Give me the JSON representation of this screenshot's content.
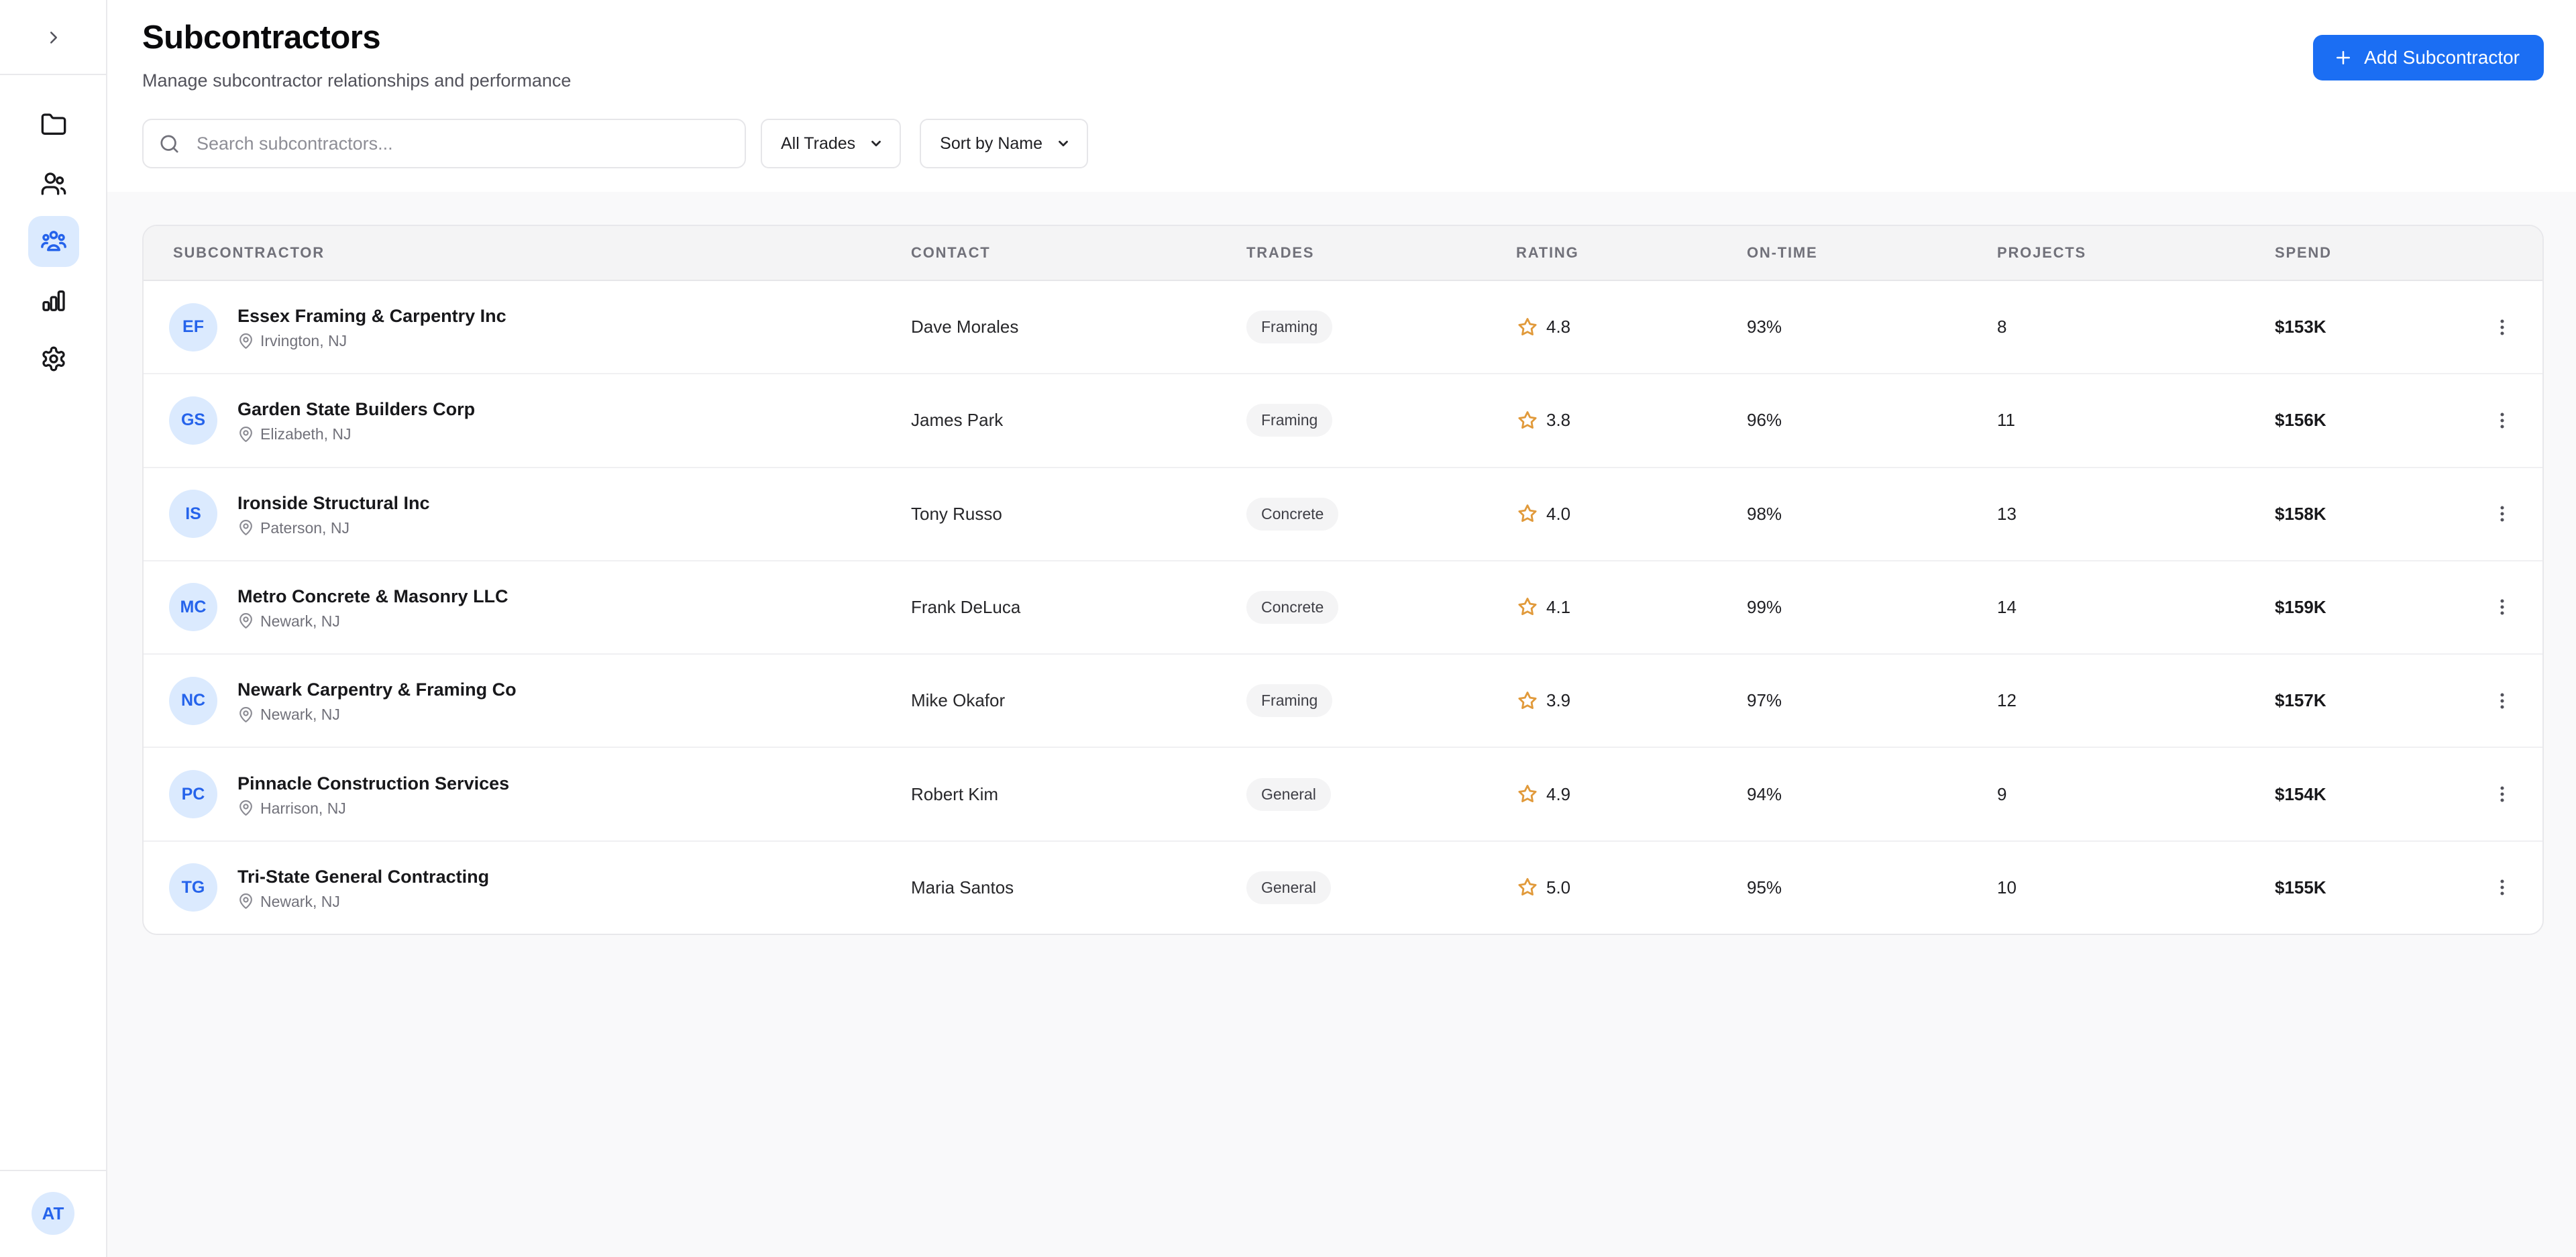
{
  "sidebar": {
    "nav": [
      {
        "id": "projects",
        "icon": "folder-icon"
      },
      {
        "id": "contacts",
        "icon": "users-icon"
      },
      {
        "id": "subcontractors",
        "icon": "team-icon",
        "active": true
      },
      {
        "id": "reports",
        "icon": "bar-chart-icon"
      },
      {
        "id": "settings",
        "icon": "gear-icon"
      }
    ],
    "avatar_initials": "AT"
  },
  "header": {
    "title": "Subcontractors",
    "subtitle": "Manage subcontractor relationships and performance",
    "add_button_label": "Add Subcontractor"
  },
  "toolbar": {
    "search_placeholder": "Search subcontractors...",
    "trades_filter_value": "All Trades",
    "sort_value": "Sort by Name"
  },
  "table": {
    "columns": [
      "SUBCONTRACTOR",
      "CONTACT",
      "TRADES",
      "RATING",
      "ON-TIME",
      "PROJECTS",
      "SPEND"
    ],
    "rows": [
      {
        "initials": "EF",
        "name": "Essex Framing & Carpentry Inc",
        "location": "Irvington, NJ",
        "contact": "Dave Morales",
        "trade": "Framing",
        "rating": "4.8",
        "on_time": "93%",
        "projects": "8",
        "spend": "$153K"
      },
      {
        "initials": "GS",
        "name": "Garden State Builders Corp",
        "location": "Elizabeth, NJ",
        "contact": "James Park",
        "trade": "Framing",
        "rating": "3.8",
        "on_time": "96%",
        "projects": "11",
        "spend": "$156K"
      },
      {
        "initials": "IS",
        "name": "Ironside Structural Inc",
        "location": "Paterson, NJ",
        "contact": "Tony Russo",
        "trade": "Concrete",
        "rating": "4.0",
        "on_time": "98%",
        "projects": "13",
        "spend": "$158K"
      },
      {
        "initials": "MC",
        "name": "Metro Concrete & Masonry LLC",
        "location": "Newark, NJ",
        "contact": "Frank DeLuca",
        "trade": "Concrete",
        "rating": "4.1",
        "on_time": "99%",
        "projects": "14",
        "spend": "$159K"
      },
      {
        "initials": "NC",
        "name": "Newark Carpentry & Framing Co",
        "location": "Newark, NJ",
        "contact": "Mike Okafor",
        "trade": "Framing",
        "rating": "3.9",
        "on_time": "97%",
        "projects": "12",
        "spend": "$157K"
      },
      {
        "initials": "PC",
        "name": "Pinnacle Construction Services",
        "location": "Harrison, NJ",
        "contact": "Robert Kim",
        "trade": "General",
        "rating": "4.9",
        "on_time": "94%",
        "projects": "9",
        "spend": "$154K"
      },
      {
        "initials": "TG",
        "name": "Tri-State General Contracting",
        "location": "Newark, NJ",
        "contact": "Maria Santos",
        "trade": "General",
        "rating": "5.0",
        "on_time": "95%",
        "projects": "10",
        "spend": "$155K"
      }
    ]
  },
  "colors": {
    "accent_blue": "#1b6ef3",
    "link_blue": "#2563eb",
    "avatar_bg": "#dbeafe",
    "star_amber": "#e19a3b",
    "badge_bg": "#f4f4f5",
    "header_row_bg": "#f4f4f5",
    "content_bg": "#f9f9fa",
    "border_gray": "#e8e8eb"
  }
}
